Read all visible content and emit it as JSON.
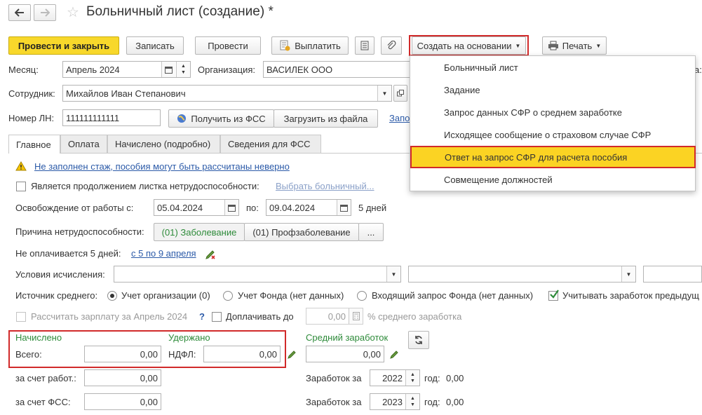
{
  "window": {
    "title": "Больничный лист (создание) *"
  },
  "toolbar": {
    "post_close": "Провести и закрыть",
    "save": "Записать",
    "post": "Провести",
    "pay": "Выплатить",
    "create_based": "Создать на основании",
    "print": "Печать"
  },
  "header": {
    "month_label": "Месяц:",
    "month_value": "Апрель 2024",
    "org_label": "Организация:",
    "org_value": "ВАСИЛЕК ООО",
    "employee_label": "Сотрудник:",
    "employee_value": "Михайлов Иван Степанович",
    "ln_label": "Номер ЛН:",
    "ln_value": "111111111111",
    "get_fss": "Получить из ФСС",
    "load_file": "Загрузить из файла",
    "req_link": "Запо",
    "right_cut": "а:"
  },
  "dropdown_menu": {
    "items": [
      "Больничный лист",
      "Задание",
      "Запрос данных СФР о среднем заработке",
      "Исходящее сообщение о страховом случае СФР",
      "Ответ на запрос СФР для расчета пособия",
      "Совмещение должностей"
    ],
    "highlighted_index": 4
  },
  "tabs": [
    "Главное",
    "Оплата",
    "Начислено (подробно)",
    "Сведения для ФСС"
  ],
  "main": {
    "warning": "Не заполнен стаж, пособия могут быть рассчитаны неверно",
    "continuation_label": "Является продолжением листка нетрудоспособности:",
    "choose_sick_leave": "Выбрать больничный...",
    "release_label": "Освобождение от работы с:",
    "date_from": "05.04.2024",
    "to_label": "по:",
    "date_to": "09.04.2024",
    "days": "5 дней",
    "reason_label": "Причина нетрудоспособности:",
    "reason_disease": "(01) Заболевание",
    "reason_prof": "(01) Профзаболевание",
    "reason_more": "...",
    "not_paid_label": "Не оплачивается 5 дней:",
    "not_paid_link": "с 5 по 9 апреля",
    "conditions_label": "Условия исчисления:",
    "source_label": "Источник среднего:",
    "source_org": "Учет организации (0)",
    "source_fund": "Учет Фонда (нет данных)",
    "source_incoming": "Входящий запрос Фонда (нет данных)",
    "consider_earnings": "Учитывать заработок предыдущ",
    "calc_salary": "Рассчитать зарплату за Апрель 2024",
    "question": "?",
    "pay_extra": "Доплачивать до",
    "pay_extra_value": "0,00",
    "pay_extra_suffix": "% среднего заработка",
    "accrued_title": "Начислено",
    "withheld_title": "Удержано",
    "total_label": "Всего:",
    "total_value": "0,00",
    "ndfl_label": "НДФЛ:",
    "ndfl_value": "0,00",
    "avg_title": "Средний заработок",
    "avg_value": "0,00",
    "employer_label": "за счет работ.:",
    "employer_value": "0,00",
    "fss_label": "за счет ФСС:",
    "fss_value": "0,00",
    "earnings_label": "Заработок за",
    "year1": "2022",
    "year2": "2023",
    "year_label": "год:",
    "year1_value": "0,00",
    "year2_value": "0,00"
  },
  "colors": {
    "accent": "#f8d82b",
    "highlight_border": "#d12a2a",
    "link": "#2b5aa8",
    "green": "#2e8b3a"
  }
}
